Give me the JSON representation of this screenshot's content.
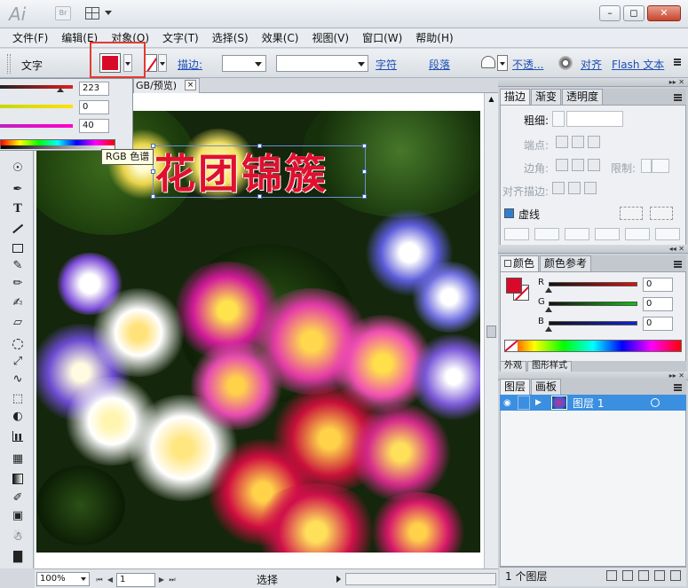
{
  "titlebar": {
    "app_logo": "Ai",
    "bridge_label": "Br",
    "win_min": "–",
    "win_restore": "◻",
    "win_close": "✕"
  },
  "menu": [
    "文件(F)",
    "编辑(E)",
    "对象(O)",
    "文字(T)",
    "选择(S)",
    "效果(C)",
    "视图(V)",
    "窗口(W)",
    "帮助(H)"
  ],
  "controlbar": {
    "tool_label": "文字",
    "fill_color": "#d90a29",
    "stroke_label": "描边:",
    "char_link": "字符",
    "para_link": "段落",
    "opacity_label": "不透...",
    "align_label": "对齐",
    "flash_label": "Flash 文本"
  },
  "color_flyout": {
    "values": [
      "223",
      "0",
      "40"
    ]
  },
  "tooltip": "RGB 色谱",
  "document": {
    "tab_title": "GB/预览)",
    "tab_close": "×",
    "art_text": "花团锦簇"
  },
  "statusbar": {
    "zoom": "100%",
    "page": "1",
    "tool": "选择"
  },
  "stroke_panel": {
    "tabs": [
      "描边",
      "渐变",
      "透明度"
    ],
    "weight_label": "粗细:",
    "cap_label": "端点:",
    "corner_label": "边角:",
    "limit_label": "限制:",
    "align_label": "对齐描边:",
    "dashed_label": "虚线"
  },
  "color_panel": {
    "tabs": [
      "颜色",
      "颜色参考"
    ],
    "fill_color": "#d90a29",
    "channels": [
      {
        "name": "R",
        "value": "0"
      },
      {
        "name": "G",
        "value": "0"
      },
      {
        "name": "B",
        "value": "0"
      }
    ],
    "collapsed_tabs": [
      "外观",
      "图形样式"
    ]
  },
  "layers_panel": {
    "tabs": [
      "图层",
      "画板"
    ],
    "layer_name": "图层 1",
    "footer": "1 个图层"
  }
}
